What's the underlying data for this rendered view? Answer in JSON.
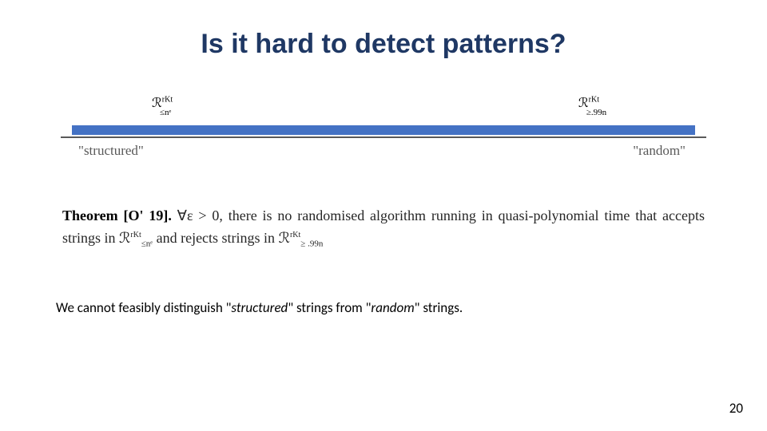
{
  "title": "Is it hard to detect patterns?",
  "spectrum": {
    "leftLabel": "ℛ",
    "leftSup": "rKt",
    "leftSub": "≤nᵉ",
    "rightLabel": "ℛ",
    "rightSup": "rKt",
    "rightSub": "≥.99n",
    "axisLeft": "\"structured\"",
    "axisRight": "\"random\""
  },
  "theorem": {
    "prefix": "Theorem [O' 19].",
    "body1": "∀ε > 0, there is no randomised algorithm running in quasi-polynomial time that accepts strings in ",
    "mid": " and rejects strings in ",
    "set1_base": "ℛ",
    "set1_sup": "rKt",
    "set1_sub": "≤nᵉ",
    "set2_base": "ℛ",
    "set2_sup": "rKt",
    "set2_sub": "≥ .99n"
  },
  "conclusion": {
    "pre": "We cannot feasibly distinguish \"",
    "word1": "structured",
    "mid": "\" strings from \"",
    "word2": "random",
    "post": "\" strings."
  },
  "pageNumber": "20"
}
